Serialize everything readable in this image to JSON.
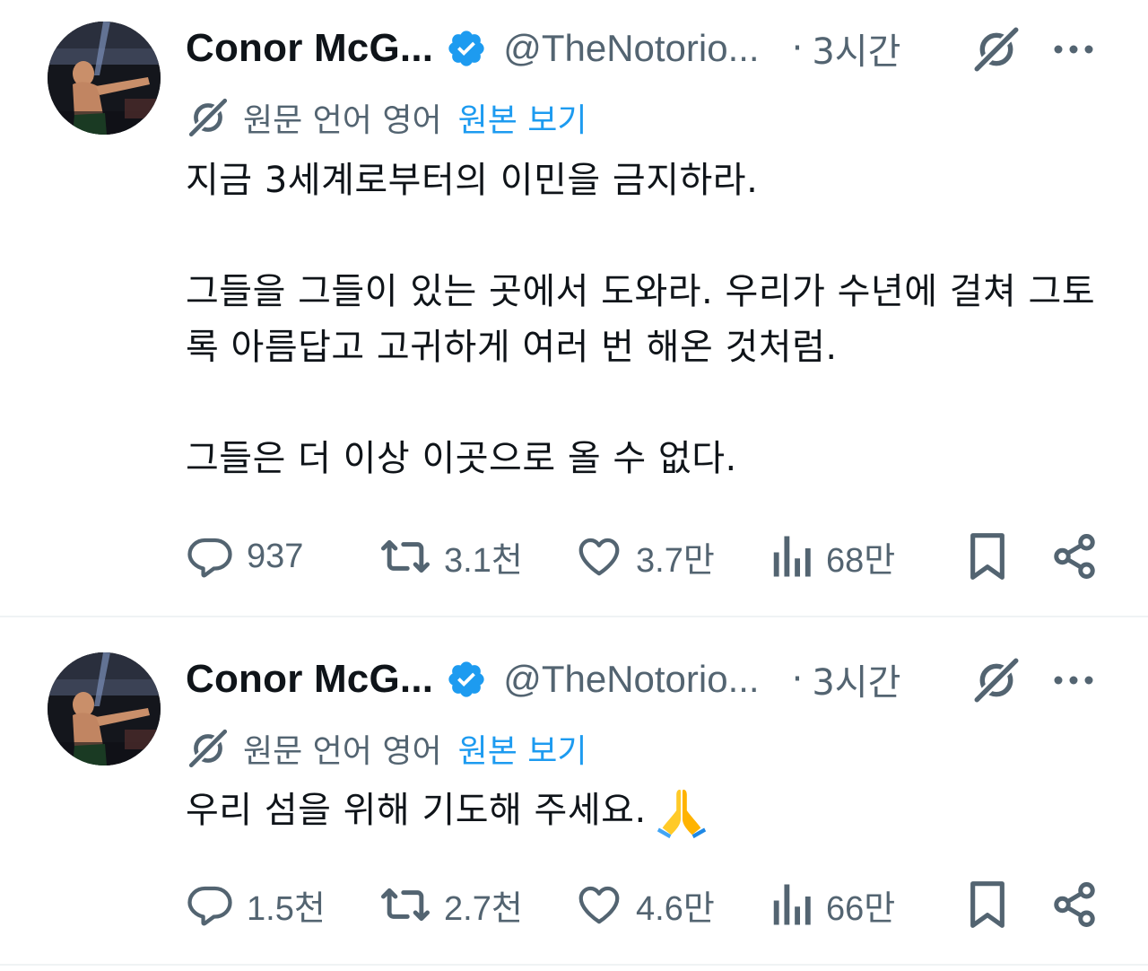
{
  "tweets": [
    {
      "display_name": "Conor McG...",
      "handle": "@TheNotorio...",
      "separator": "·",
      "time": "3시간",
      "translation": {
        "label": "원문 언어 영어",
        "show_original": "원본 보기"
      },
      "paragraphs": [
        "지금 3세계로부터의 이민을 금지하라.",
        "그들을 그들이 있는 곳에서 도와라. 우리가 수년에 걸쳐 그토록 아름답고 고귀하게 여러 번 해온 것처럼.",
        "그들은 더 이상 이곳으로 올 수 없다."
      ],
      "metrics": {
        "replies": "937",
        "reposts": "3.1천",
        "likes": "3.7만",
        "views": "68만"
      }
    },
    {
      "display_name": "Conor McG...",
      "handle": "@TheNotorio...",
      "separator": "·",
      "time": "3시간",
      "translation": {
        "label": "원문 언어 영어",
        "show_original": "원본 보기"
      },
      "paragraphs": [
        "우리 섬을 위해 기도해 주세요."
      ],
      "emoji": "folded-hands",
      "metrics": {
        "replies": "1.5천",
        "reposts": "2.7천",
        "likes": "4.6만",
        "views": "66만"
      }
    }
  ],
  "colors": {
    "text_primary": "#0f1419",
    "text_secondary": "#536471",
    "link_blue": "#1d9bf0",
    "verified_blue": "#1d9bf0",
    "divider": "#eff3f4"
  },
  "icons": {
    "verified": "verified-badge-icon",
    "grok": "grok-icon",
    "more": "more-dots-icon",
    "translate": "grok-translate-icon",
    "reply": "reply-bubble-icon",
    "repost": "repost-arrows-icon",
    "like": "heart-icon",
    "views": "analytics-bars-icon",
    "bookmark": "bookmark-icon",
    "share": "share-icon"
  }
}
